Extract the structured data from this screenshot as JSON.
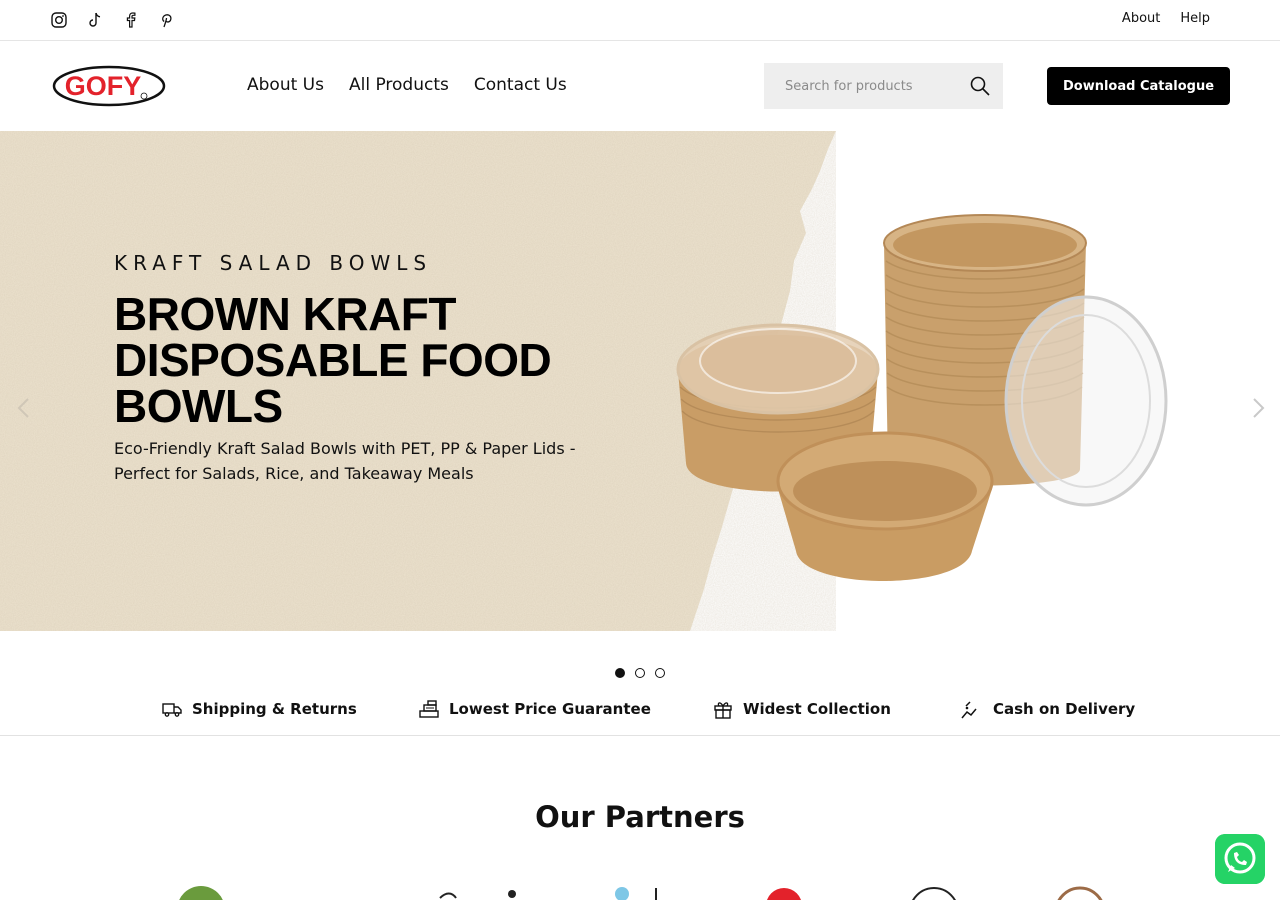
{
  "topbar": {
    "social_icons": [
      "instagram-icon",
      "tiktok-icon",
      "facebook-icon",
      "pinterest-icon"
    ],
    "links": [
      "About",
      "Help"
    ]
  },
  "header": {
    "logo_text": "GOFY",
    "nav": [
      "About Us",
      "All Products",
      "Contact Us"
    ],
    "search_placeholder": "Search for products",
    "cta_label": "Download Catalogue"
  },
  "hero": {
    "eyebrow": "KRAFT SALAD BOWLS",
    "title": "BROWN KRAFT DISPOSABLE FOOD BOWLS",
    "subtitle": "Eco-Friendly Kraft Salad Bowls with PET, PP & Paper Lids - Perfect for Salads, Rice, and Takeaway Meals",
    "slides": 3,
    "active_slide": 1
  },
  "features": [
    {
      "label": "Shipping & Returns",
      "icon": "truck-icon"
    },
    {
      "label": "Lowest Price Guarantee",
      "icon": "cash-register-icon"
    },
    {
      "label": "Widest Collection",
      "icon": "gift-icon"
    },
    {
      "label": "Cash on Delivery",
      "icon": "delivery-hand-icon"
    }
  ],
  "partners": {
    "title": "Our Partners"
  },
  "colors": {
    "accent": "#000000",
    "logo_red": "#e3222b",
    "kraft": "#c9a06c",
    "paper": "#ede3cf",
    "whatsapp": "#25d366"
  }
}
